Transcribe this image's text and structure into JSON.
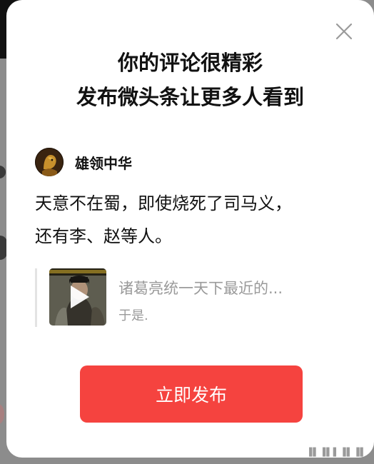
{
  "dialog": {
    "title_line1": "你的评论很精彩",
    "title_line2": "发布微头条让更多人看到",
    "close_icon": "close-icon"
  },
  "author": {
    "name": "雄领中华",
    "avatar_icon": "avatar"
  },
  "comment": {
    "line1": "天意不在蜀，即使烧死了司马义，",
    "line2": "还有李、赵等人。"
  },
  "quoted_article": {
    "title": "诸葛亮统一天下最近的...",
    "subtitle": "于是.",
    "thumbnail_icon": "video-play-icon"
  },
  "publish_button": {
    "label": "立即发布"
  },
  "colors": {
    "accent": "#f5433f",
    "muted_text": "#9a9a9a",
    "primary_text": "#111111"
  }
}
